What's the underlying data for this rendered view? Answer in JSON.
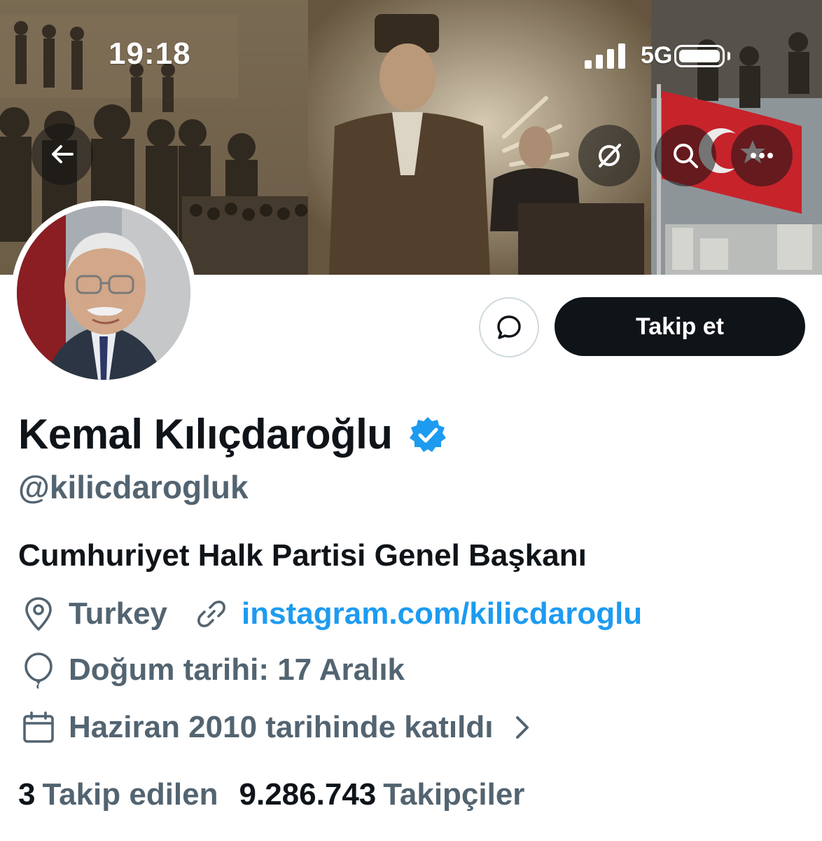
{
  "status_bar": {
    "time": "19:18",
    "network": "5G"
  },
  "profile": {
    "display_name": "Kemal Kılıçdaroğlu",
    "handle": "@kilicdarogluk",
    "bio": "Cumhuriyet Halk Partisi Genel Başkanı",
    "location": "Turkey",
    "website": "instagram.com/kilicdaroglu",
    "birthday": "Doğum tarihi: 17 Aralık",
    "joined": "Haziran 2010 tarihinde katıldı",
    "following_count": "3",
    "following_label": "Takip edilen",
    "followers_count": "9.286.743",
    "followers_label": "Takipçiler"
  },
  "actions": {
    "follow_label": "Takip et"
  },
  "icons": {
    "back": "arrow-left-icon",
    "grok": "grok-icon",
    "search": "search-icon",
    "more": "more-horizontal-icon",
    "message": "message-bubble-icon",
    "verified": "verified-badge-icon",
    "location": "location-pin-icon",
    "link": "link-icon",
    "birthday": "balloon-icon",
    "calendar": "calendar-icon",
    "chevron": "chevron-right-icon"
  },
  "colors": {
    "accent": "#1d9bf0",
    "text_primary": "#0f1419",
    "text_secondary": "#536471",
    "button_dark": "#0f1419"
  }
}
